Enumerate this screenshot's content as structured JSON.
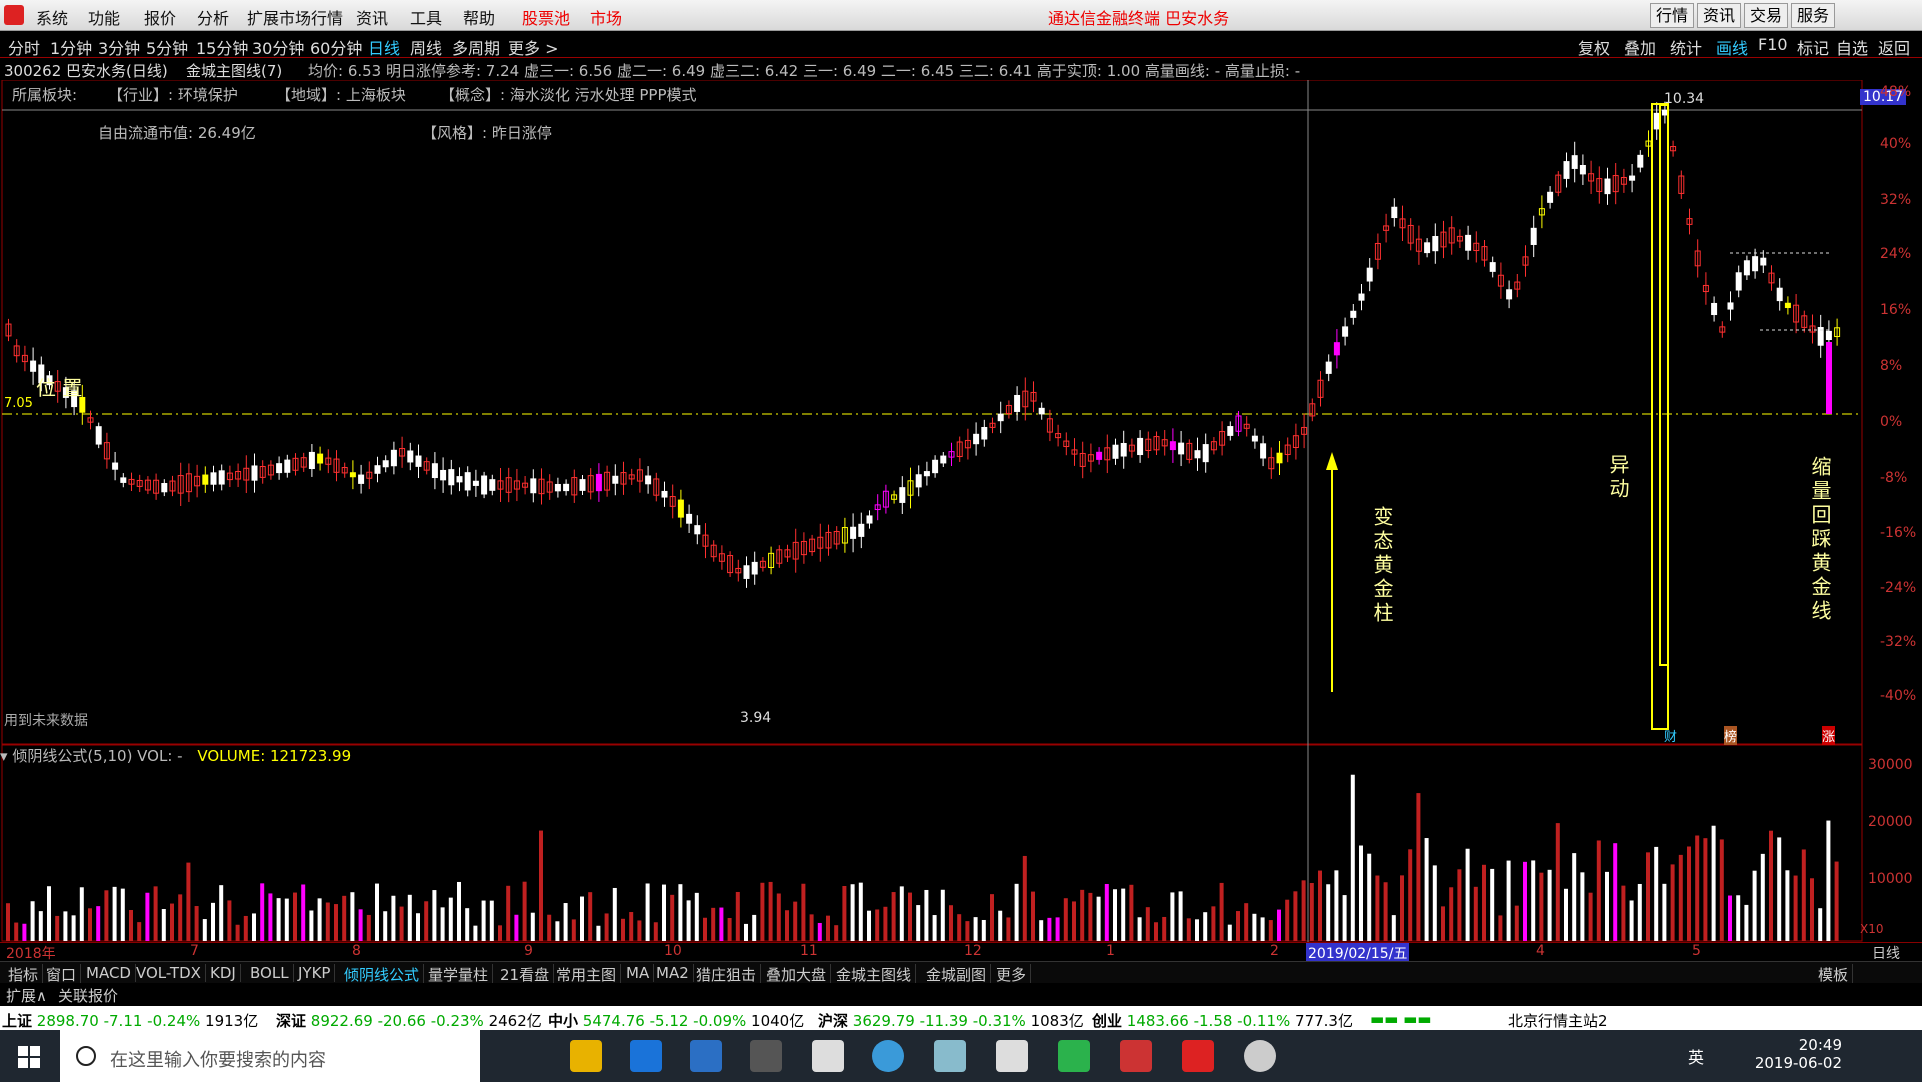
{
  "menubar": {
    "items": [
      "系统",
      "功能",
      "报价",
      "分析",
      "扩展市场行情",
      "资讯",
      "工具",
      "帮助"
    ],
    "hot_items": [
      "股票池",
      "市场"
    ],
    "title": "通达信金融终端  巴安水务",
    "right_buttons": [
      "行情",
      "资讯",
      "交易",
      "服务"
    ]
  },
  "periods": {
    "items": [
      "分时",
      "1分钟",
      "3分钟",
      "5分钟",
      "15分钟",
      "30分钟",
      "60分钟",
      "日线",
      "周线",
      "多周期",
      "更多 >"
    ],
    "active": "日线",
    "right_items": [
      "复权",
      "叠加",
      "统计",
      "画线",
      "F10",
      "标记",
      "自选",
      "返回"
    ]
  },
  "info": {
    "stock": "300262 巴安水务(日线)",
    "formula": "金城主图线(7)",
    "stats": "均价: 6.53  明日涨停参考: 7.24  虚三一: 6.56  虚二一: 6.49  虚三二: 6.42  三一: 6.49  二一: 6.45  三二: 6.41  高于实顶: 1.00  高量画线: - 高量止损: -",
    "sector_label": "所属板块:",
    "industry": "【行业】: 环境保护",
    "region": "【地域】: 上海板块",
    "concept": "【概念】: 海水淡化 污水处理 PPP模式",
    "float_cap": "自由流通市值: 26.49亿",
    "style": "【风格】: 昨日涨停",
    "future_note": "用到未来数据",
    "price_now": "10.17",
    "price_high_label": "10.34",
    "price_low_label": "3.94",
    "baseline_label": "7.05",
    "position_label": "位 置"
  },
  "annotations": {
    "a1": "变态黄金柱",
    "a2": "异动",
    "a3": "缩量回踩黄金线"
  },
  "tags": {
    "cai": "财",
    "bang": "榜",
    "zhang": "涨"
  },
  "volume": {
    "header_formula": "倾阴线公式(5,10)  VOL: -",
    "header_value": "VOLUME: 121723.99",
    "scale": [
      "30000",
      "20000",
      "10000"
    ],
    "multiplier": "X10"
  },
  "y_axis_pct": [
    "48%",
    "40%",
    "32%",
    "24%",
    "16%",
    "8%",
    "0%",
    "-8%",
    "-16%",
    "-24%",
    "-32%",
    "-40%"
  ],
  "dates": {
    "items": [
      "2018年",
      "7",
      "8",
      "9",
      "10",
      "11",
      "12",
      "1",
      "2",
      "2019/02/15/五",
      "4",
      "5"
    ],
    "right": "日线"
  },
  "tabs": {
    "items": [
      "指标",
      "窗口",
      "MACD",
      "VOL-TDX",
      "KDJ",
      "BOLL",
      "JYKP",
      "倾阴线公式",
      "量学量柱",
      "21看盘",
      "常用主图",
      "MA",
      "MA2",
      "猎庄狙击",
      "叠加大盘",
      "金城主图线",
      "金城副图",
      "更多"
    ],
    "active": "倾阴线公式",
    "right": "模板"
  },
  "ext": {
    "items": [
      "扩展∧",
      "关联报价"
    ]
  },
  "indexbar": [
    {
      "name": "上证",
      "val": "2898.70  -7.11  -0.24%",
      "amt": "1913亿"
    },
    {
      "name": "深证",
      "val": "8922.69  -20.66  -0.23%",
      "amt": "2462亿"
    },
    {
      "name": "中小",
      "val": "5474.76  -5.12  -0.09%",
      "amt": "1040亿"
    },
    {
      "name": "沪深",
      "val": "3629.79  -11.39  -0.31%",
      "amt": "1083亿"
    },
    {
      "name": "创业",
      "val": "1483.66  -1.58  -0.11%",
      "amt": "777.3亿"
    }
  ],
  "server": "北京行情主站2",
  "taskbar": {
    "search_placeholder": "在这里输入你要搜索的内容",
    "time": "20:49",
    "date": "2019-06-02",
    "lang": "英"
  },
  "colors": {
    "up": "#ff3030",
    "down": "#ffffff",
    "gold": "#ffff00",
    "magenta": "#ff00ff",
    "cyan": "#33ccff"
  }
}
